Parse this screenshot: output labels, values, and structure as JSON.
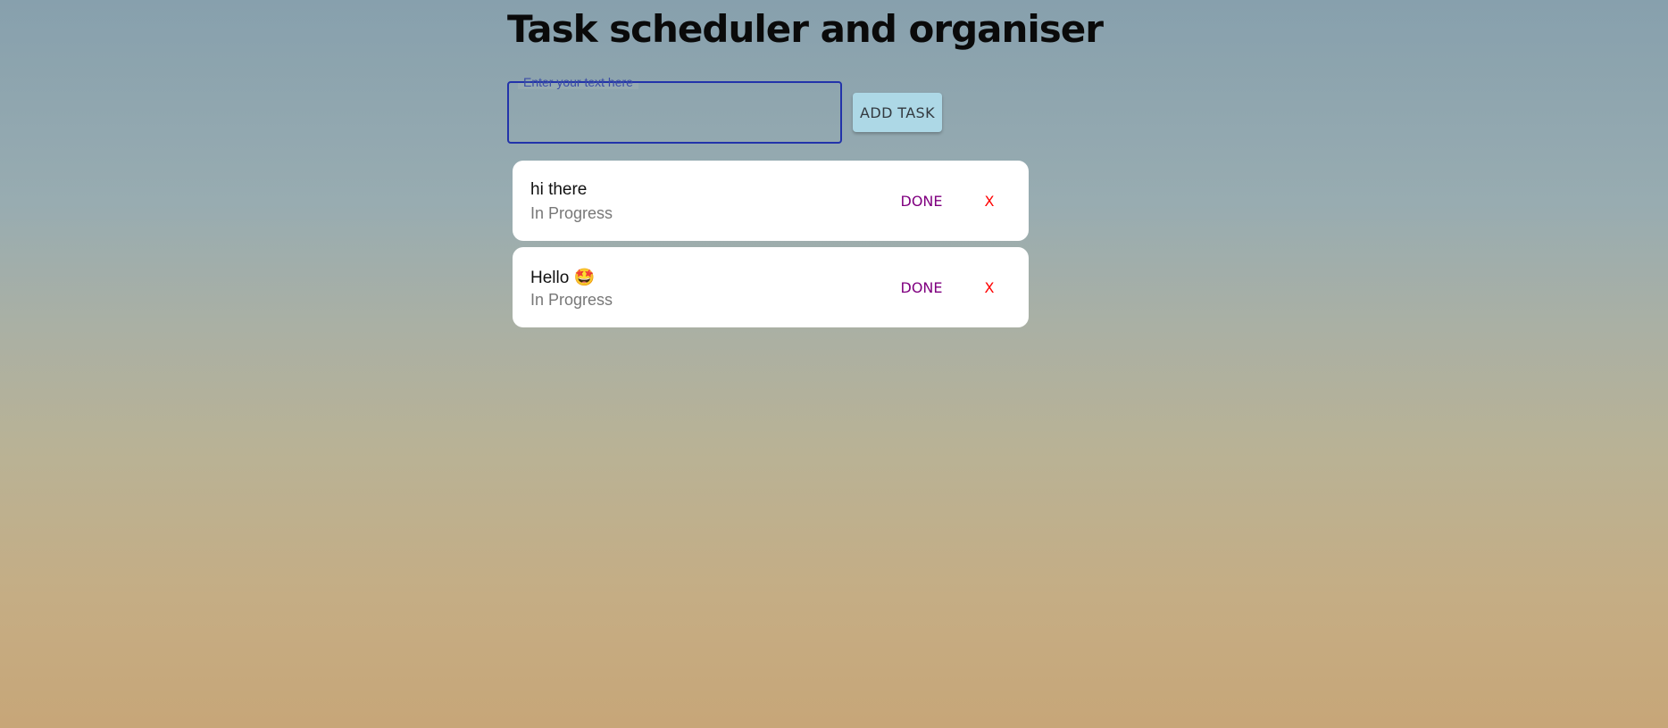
{
  "page": {
    "title": "Task scheduler and organiser"
  },
  "input": {
    "label": "Enter your text here",
    "value": ""
  },
  "add_button_label": "ADD TASK",
  "tasks": [
    {
      "title": "hi there",
      "status": "In Progress",
      "done_label": "DONE",
      "delete_label": "X"
    },
    {
      "title": "Hello 🤩",
      "status": "In Progress",
      "done_label": "DONE",
      "delete_label": "X"
    }
  ],
  "colors": {
    "input_border": "#2233aa",
    "add_button_bg": "#add8e6",
    "done_text": "#800080",
    "delete_text": "#ff0000"
  }
}
